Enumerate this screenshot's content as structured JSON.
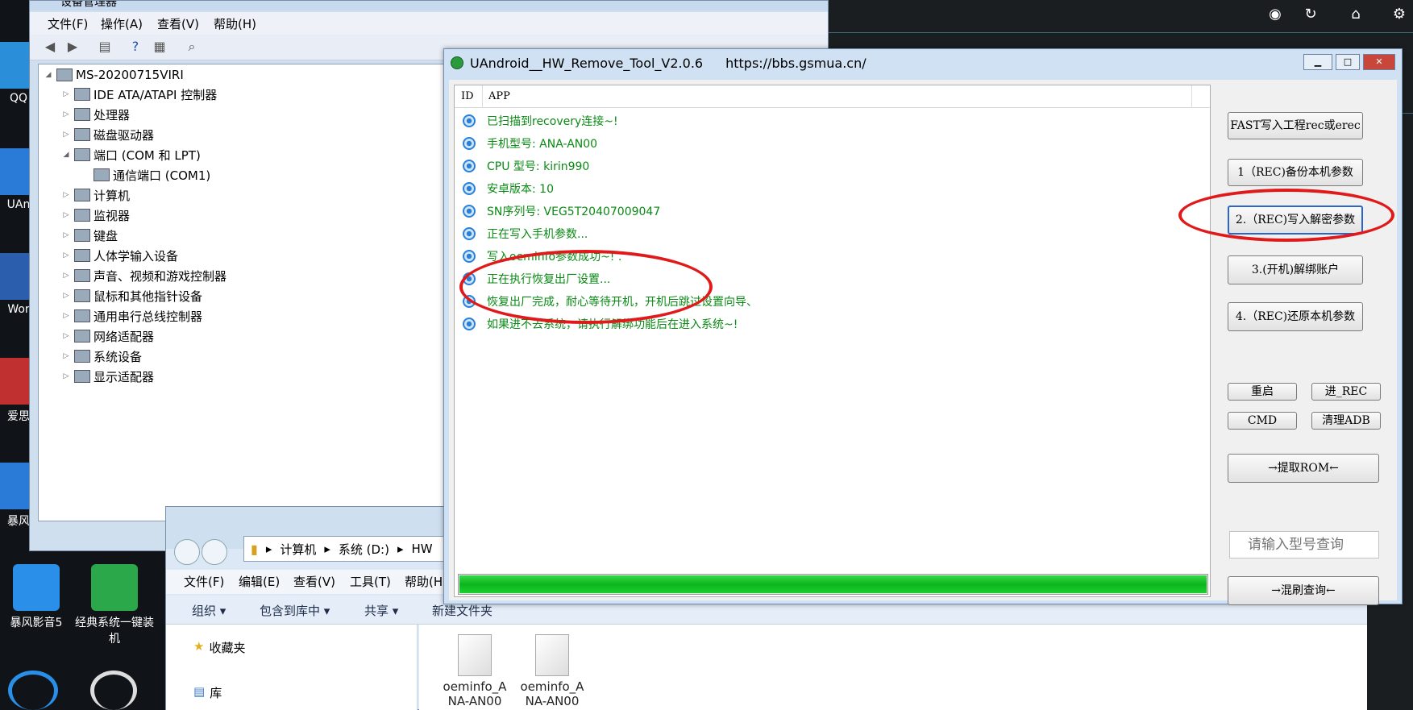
{
  "desktop": {
    "icons": [
      {
        "label": "QQ",
        "color": "#2a8fd8"
      },
      {
        "label": "UAn",
        "color": "#2a7ad8"
      },
      {
        "label": "Wor",
        "color": "#2b5fae"
      },
      {
        "label": "爱思",
        "color": "#c03030"
      },
      {
        "label": "暴风",
        "color": "#2a7ad8"
      },
      {
        "label": "暴风影音5",
        "color": "#2a8fe8"
      },
      {
        "label": "经典系统一键装机",
        "color": "#2aa84a"
      }
    ],
    "taskbar_icons": [
      "globe-icon",
      "refresh-icon",
      "home-icon",
      "gear-icon"
    ]
  },
  "device_manager": {
    "title": "设备管理器",
    "menu": [
      "文件(F)",
      "操作(A)",
      "查看(V)",
      "帮助(H)"
    ],
    "tree": {
      "root": "MS-20200715VIRI",
      "items": [
        {
          "label": "IDE ATA/ATAPI 控制器",
          "expanded": false
        },
        {
          "label": "处理器",
          "expanded": false
        },
        {
          "label": "磁盘驱动器",
          "expanded": false
        },
        {
          "label": "端口 (COM 和 LPT)",
          "expanded": true
        },
        {
          "label": "通信端口 (COM1)",
          "child": true
        },
        {
          "label": "计算机",
          "expanded": false
        },
        {
          "label": "监视器",
          "expanded": false
        },
        {
          "label": "键盘",
          "expanded": false
        },
        {
          "label": "人体学输入设备",
          "expanded": false
        },
        {
          "label": "声音、视频和游戏控制器",
          "expanded": false
        },
        {
          "label": "鼠标和其他指针设备",
          "expanded": false
        },
        {
          "label": "通用串行总线控制器",
          "expanded": false
        },
        {
          "label": "网络适配器",
          "expanded": false
        },
        {
          "label": "系统设备",
          "expanded": false
        },
        {
          "label": "显示适配器",
          "expanded": false
        }
      ]
    }
  },
  "explorer": {
    "breadcrumb": [
      "计算机",
      "系统 (D:)",
      "HW"
    ],
    "menu": [
      "文件(F)",
      "编辑(E)",
      "查看(V)",
      "工具(T)",
      "帮助(H)"
    ],
    "commands": [
      "组织 ▾",
      "包含到库中 ▾",
      "共享 ▾",
      "新建文件夹"
    ],
    "nav": [
      "收藏夹",
      "库"
    ],
    "files": [
      {
        "name_line1": "oeminfo_A",
        "name_line2": "NA-AN00"
      },
      {
        "name_line1": "oeminfo_A",
        "name_line2": "NA-AN00"
      }
    ]
  },
  "tool": {
    "title": "UAndroid__HW_Remove_Tool_V2.0.6",
    "url": "https://bbs.gsmua.cn/",
    "columns": {
      "id": "ID",
      "app": "APP"
    },
    "log": [
      "已扫描到recovery连接~!",
      "手机型号: ANA-AN00",
      "CPU 型号: kirin990",
      "安卓版本: 10",
      "SN序列号: VEG5T20407009047",
      "正在写入手机参数...",
      "写入oeminfo参数成功~! .",
      "正在执行恢复出厂设置...",
      "恢复出厂完成，耐心等待开机，开机后跳过设置向导、",
      "如果进不去系统，请执行解绑功能后在进入系统~!"
    ],
    "log_color": "#0a8a14",
    "progress": 1.0,
    "progress_color": "#0bb51d",
    "buttons": {
      "fast": "FAST写入工程rec或erec",
      "backup": "1（REC)备份本机参数",
      "write_decrypt": "2.（REC)写入解密参数",
      "unbind": "3.(开机)解绑账户",
      "restore": "4.（REC)还原本机参数",
      "reboot": "重启",
      "enter_rec": "进_REC",
      "cmd": "CMD",
      "clean_adb": "清理ADB",
      "extract_rom": "→提取ROM←",
      "mixed_query": "→混刷查询←"
    },
    "model_input_placeholder": "请输入型号查询",
    "highlight_color": "#e01a1a"
  }
}
